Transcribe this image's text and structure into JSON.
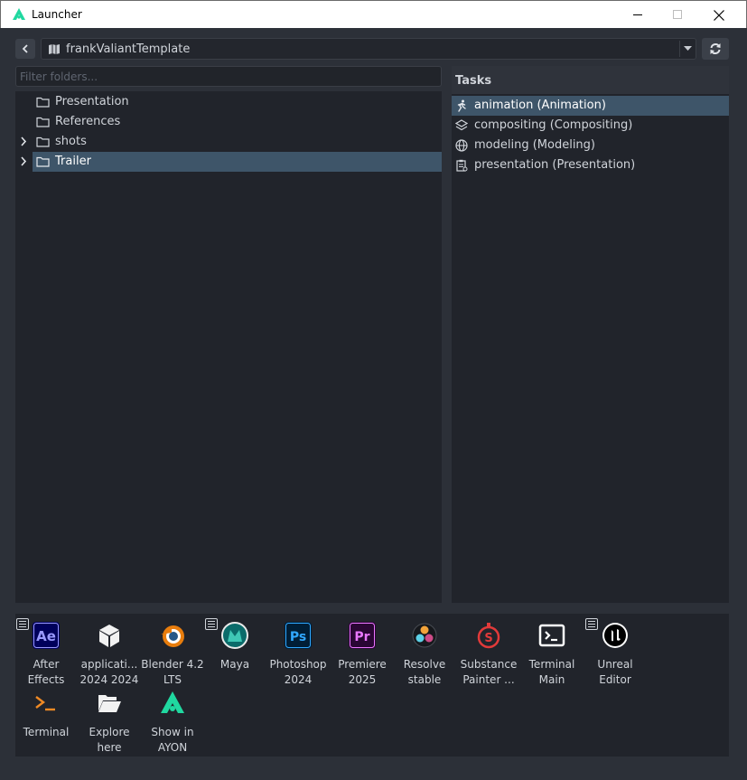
{
  "window": {
    "title": "Launcher"
  },
  "project": {
    "name": "frankValiantTemplate"
  },
  "folders": {
    "filter_placeholder": "Filter folders...",
    "items": [
      {
        "label": "Presentation",
        "expandable": false,
        "selected": false
      },
      {
        "label": "References",
        "expandable": false,
        "selected": false
      },
      {
        "label": "shots",
        "expandable": true,
        "selected": false
      },
      {
        "label": "Trailer",
        "expandable": true,
        "selected": true
      }
    ]
  },
  "tasks": {
    "header": "Tasks",
    "items": [
      {
        "label": "animation (Animation)",
        "icon": "running-icon",
        "selected": true
      },
      {
        "label": "compositing (Compositing)",
        "icon": "layers-icon",
        "selected": false
      },
      {
        "label": "modeling (Modeling)",
        "icon": "globe-icon",
        "selected": false
      },
      {
        "label": "presentation (Presentation)",
        "icon": "clipboard-icon",
        "selected": false
      }
    ]
  },
  "apps": [
    {
      "label": "After\nEffects",
      "icon": "after-effects-icon",
      "has_menu": true
    },
    {
      "label": "applicati...\n2024 2024",
      "icon": "cube-icon",
      "has_menu": false
    },
    {
      "label": "Blender 4.2\nLTS",
      "icon": "blender-icon",
      "has_menu": false
    },
    {
      "label": "Maya",
      "icon": "maya-icon",
      "has_menu": true
    },
    {
      "label": "Photoshop\n2024",
      "icon": "photoshop-icon",
      "has_menu": false
    },
    {
      "label": "Premiere\n2025",
      "icon": "premiere-icon",
      "has_menu": false
    },
    {
      "label": "Resolve\nstable",
      "icon": "resolve-icon",
      "has_menu": false
    },
    {
      "label": "Substance\nPainter ...",
      "icon": "substance-painter-icon",
      "has_menu": false
    },
    {
      "label": "Terminal\nMain",
      "icon": "terminal-main-icon",
      "has_menu": false
    },
    {
      "label": "Unreal\nEditor",
      "icon": "unreal-icon",
      "has_menu": true
    },
    {
      "label": "Terminal",
      "icon": "terminal-icon",
      "has_menu": false
    },
    {
      "label": "Explore\nhere",
      "icon": "folder-open-icon",
      "has_menu": false
    },
    {
      "label": "Show in\nAYON",
      "icon": "ayon-icon",
      "has_menu": false
    }
  ],
  "colors": {
    "accent": "#3e5569",
    "ayon_green": "#20d8a0",
    "panel_bg": "#21242b",
    "window_bg": "#2c3038"
  }
}
